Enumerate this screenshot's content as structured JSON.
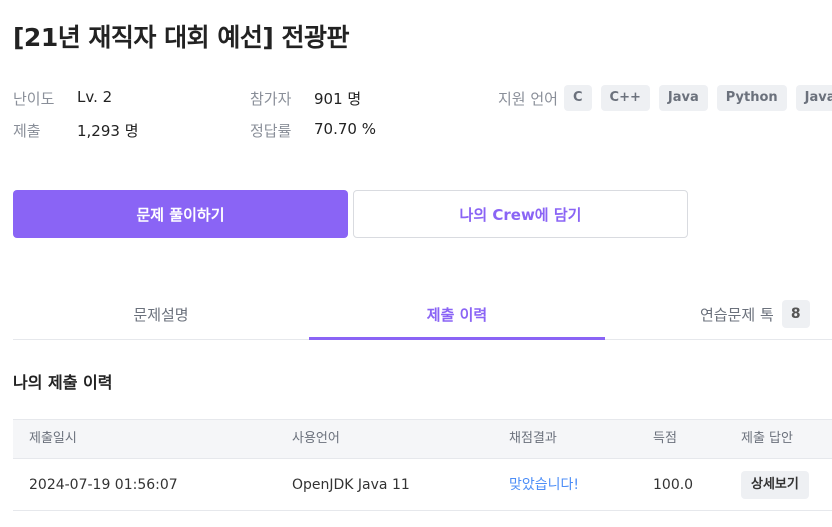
{
  "title": "[21년 재직자 대회 예선] 전광판",
  "meta": {
    "difficulty_label": "난이도",
    "difficulty_value": "Lv. 2",
    "participants_label": "참가자",
    "participants_value": "901 명",
    "submissions_label": "제출",
    "submissions_value": "1,293 명",
    "accuracy_label": "정답률",
    "accuracy_value": "70.70 %",
    "languages_label": "지원 언어",
    "languages": [
      "C",
      "C++",
      "Java",
      "Python",
      "Java"
    ]
  },
  "actions": {
    "solve_label": "문제 풀이하기",
    "crew_label": "나의 Crew에 담기"
  },
  "tabs": {
    "description": "문제설명",
    "history": "제출 이력",
    "practice": "연습문제 톡",
    "practice_count": "8",
    "active": "history"
  },
  "section_title": "나의 제출 이력",
  "table": {
    "headers": {
      "date": "제출일시",
      "language": "사용언어",
      "result": "채점결과",
      "score": "득점",
      "answer": "제출 답안"
    },
    "rows": [
      {
        "date": "2024-07-19 01:56:07",
        "language": "OpenJDK Java 11",
        "result": "맞았습니다!",
        "score": "100.0",
        "answer_button": "상세보기"
      }
    ]
  },
  "colors": {
    "accent": "#8a64f5",
    "result_success": "#4d8ef7"
  }
}
